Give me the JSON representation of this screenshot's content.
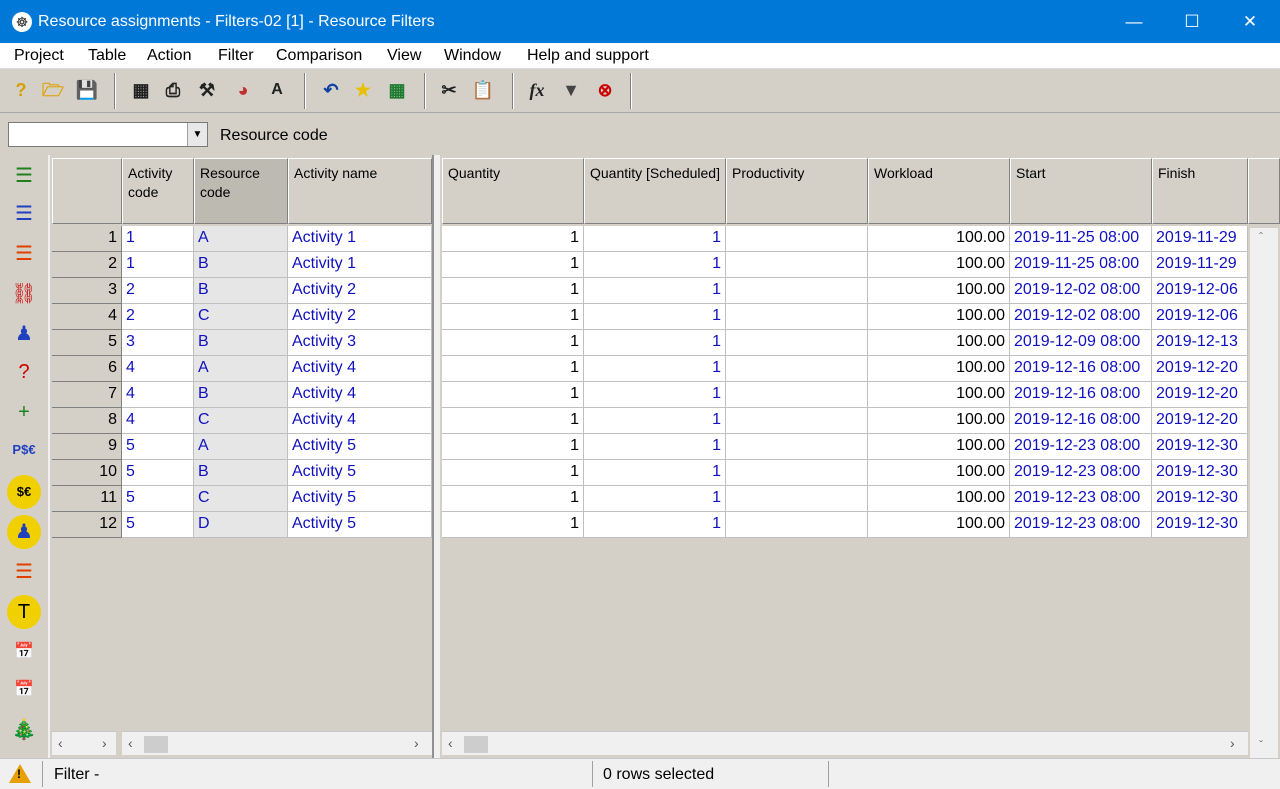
{
  "window": {
    "title": "Resource assignments - Filters-02 [1] - Resource Filters",
    "app_icon": "☸"
  },
  "menu": [
    "Project",
    "Table",
    "Action",
    "Filter",
    "Comparison",
    "View",
    "Window",
    "Help and support"
  ],
  "filter": {
    "combo_value": "",
    "label": "Resource code"
  },
  "left_columns": [
    "Activity code",
    "Resource code",
    "Activity name"
  ],
  "right_columns": [
    "Quantity",
    "Quantity [Scheduled]",
    "Productivity",
    "Workload",
    "Start",
    "Finish"
  ],
  "rows": [
    {
      "n": "1",
      "act": "1",
      "res": "A",
      "name": "Activity 1",
      "qty": "1",
      "qsch": "1",
      "prod": "",
      "work": "100.00",
      "start": "2019-11-25  08:00",
      "finish": "2019-11-29"
    },
    {
      "n": "2",
      "act": "1",
      "res": "B",
      "name": "Activity 1",
      "qty": "1",
      "qsch": "1",
      "prod": "",
      "work": "100.00",
      "start": "2019-11-25  08:00",
      "finish": "2019-11-29"
    },
    {
      "n": "3",
      "act": "2",
      "res": "B",
      "name": "Activity 2",
      "qty": "1",
      "qsch": "1",
      "prod": "",
      "work": "100.00",
      "start": "2019-12-02  08:00",
      "finish": "2019-12-06"
    },
    {
      "n": "4",
      "act": "2",
      "res": "C",
      "name": "Activity 2",
      "qty": "1",
      "qsch": "1",
      "prod": "",
      "work": "100.00",
      "start": "2019-12-02  08:00",
      "finish": "2019-12-06"
    },
    {
      "n": "5",
      "act": "3",
      "res": "B",
      "name": "Activity 3",
      "qty": "1",
      "qsch": "1",
      "prod": "",
      "work": "100.00",
      "start": "2019-12-09  08:00",
      "finish": "2019-12-13"
    },
    {
      "n": "6",
      "act": "4",
      "res": "A",
      "name": "Activity 4",
      "qty": "1",
      "qsch": "1",
      "prod": "",
      "work": "100.00",
      "start": "2019-12-16  08:00",
      "finish": "2019-12-20"
    },
    {
      "n": "7",
      "act": "4",
      "res": "B",
      "name": "Activity 4",
      "qty": "1",
      "qsch": "1",
      "prod": "",
      "work": "100.00",
      "start": "2019-12-16  08:00",
      "finish": "2019-12-20"
    },
    {
      "n": "8",
      "act": "4",
      "res": "C",
      "name": "Activity 4",
      "qty": "1",
      "qsch": "1",
      "prod": "",
      "work": "100.00",
      "start": "2019-12-16  08:00",
      "finish": "2019-12-20"
    },
    {
      "n": "9",
      "act": "5",
      "res": "A",
      "name": "Activity 5",
      "qty": "1",
      "qsch": "1",
      "prod": "",
      "work": "100.00",
      "start": "2019-12-23  08:00",
      "finish": "2019-12-30"
    },
    {
      "n": "10",
      "act": "5",
      "res": "B",
      "name": "Activity 5",
      "qty": "1",
      "qsch": "1",
      "prod": "",
      "work": "100.00",
      "start": "2019-12-23  08:00",
      "finish": "2019-12-30"
    },
    {
      "n": "11",
      "act": "5",
      "res": "C",
      "name": "Activity 5",
      "qty": "1",
      "qsch": "1",
      "prod": "",
      "work": "100.00",
      "start": "2019-12-23  08:00",
      "finish": "2019-12-30"
    },
    {
      "n": "12",
      "act": "5",
      "res": "D",
      "name": "Activity 5",
      "qty": "1",
      "qsch": "1",
      "prod": "",
      "work": "100.00",
      "start": "2019-12-23  08:00",
      "finish": "2019-12-30"
    }
  ],
  "status": {
    "filter": "Filter -",
    "selection": "0 rows selected"
  },
  "colors": {
    "titlebar": "#0078d7",
    "link_text": "#1010c0",
    "panel": "#d4d0c8"
  }
}
